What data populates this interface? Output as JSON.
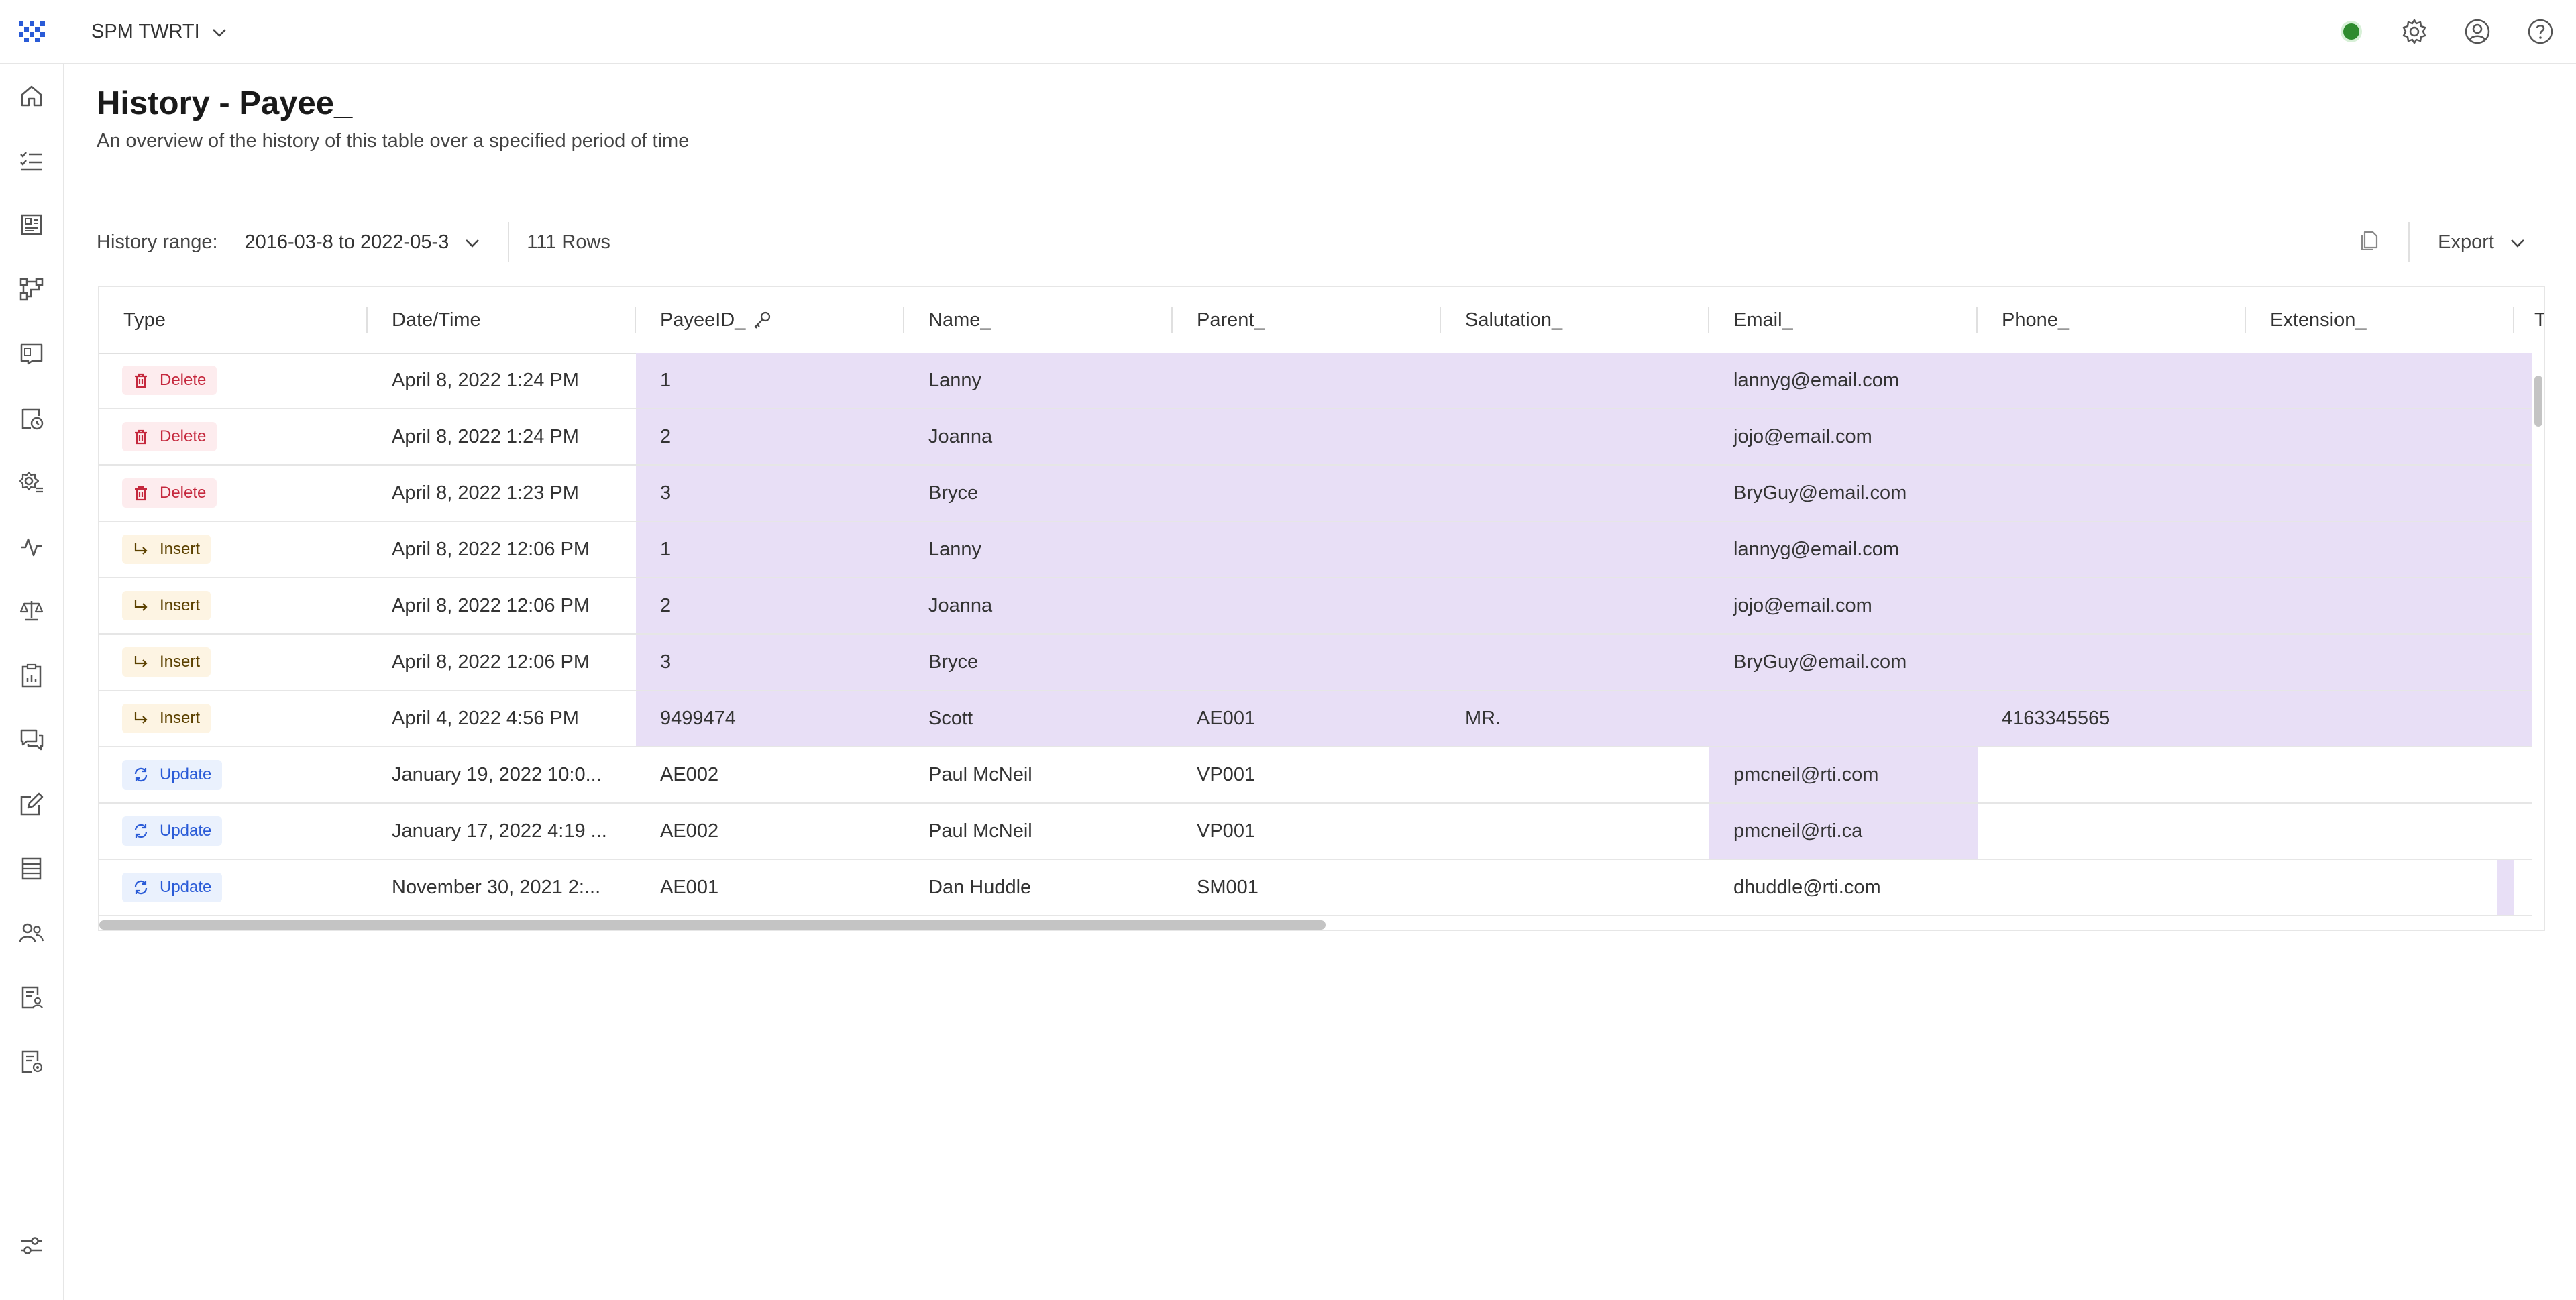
{
  "app": {
    "workspace_name": "SPM TWRTI"
  },
  "page": {
    "title": "History - Payee_",
    "subtitle": "An overview of the history of this table over a specified period of time"
  },
  "toolbar": {
    "history_range_label": "History range:",
    "history_range_value": "2016-03-8 to 2022-05-3",
    "row_count": "111 Rows",
    "export_label": "Export"
  },
  "status_color": "#2e8b2e",
  "colors": {
    "highlight": "#e8dff6",
    "delete": "#c5283d",
    "insert": "#5c4100",
    "update": "#2a5bd7"
  },
  "table": {
    "columns": [
      "Type",
      "Date/Time",
      "PayeeID_",
      "Name_",
      "Parent_",
      "Salutation_",
      "Email_",
      "Phone_",
      "Extension_",
      "T"
    ],
    "rows": [
      {
        "type": "Delete",
        "datetime": "April 8, 2022 1:24 PM",
        "payee_id": "1",
        "name": "Lanny",
        "parent": "",
        "salutation": "",
        "email": "lannyg@email.com",
        "phone": "",
        "extension": ""
      },
      {
        "type": "Delete",
        "datetime": "April 8, 2022 1:24 PM",
        "payee_id": "2",
        "name": "Joanna",
        "parent": "",
        "salutation": "",
        "email": "jojo@email.com",
        "phone": "",
        "extension": ""
      },
      {
        "type": "Delete",
        "datetime": "April 8, 2022 1:23 PM",
        "payee_id": "3",
        "name": "Bryce",
        "parent": "",
        "salutation": "",
        "email": "BryGuy@email.com",
        "phone": "",
        "extension": ""
      },
      {
        "type": "Insert",
        "datetime": "April 8, 2022 12:06 PM",
        "payee_id": "1",
        "name": "Lanny",
        "parent": "",
        "salutation": "",
        "email": "lannyg@email.com",
        "phone": "",
        "extension": ""
      },
      {
        "type": "Insert",
        "datetime": "April 8, 2022 12:06 PM",
        "payee_id": "2",
        "name": "Joanna",
        "parent": "",
        "salutation": "",
        "email": "jojo@email.com",
        "phone": "",
        "extension": ""
      },
      {
        "type": "Insert",
        "datetime": "April 8, 2022 12:06 PM",
        "payee_id": "3",
        "name": "Bryce",
        "parent": "",
        "salutation": "",
        "email": "BryGuy@email.com",
        "phone": "",
        "extension": ""
      },
      {
        "type": "Insert",
        "datetime": "April 4, 2022 4:56 PM",
        "payee_id": "9499474",
        "name": "Scott",
        "parent": "AE001",
        "salutation": "MR.",
        "email": "",
        "phone": "4163345565",
        "extension": ""
      },
      {
        "type": "Update",
        "datetime": "January 19, 2022 10:0...",
        "payee_id": "AE002",
        "name": "Paul McNeil",
        "parent": "VP001",
        "salutation": "",
        "email": "pmcneil@rti.com",
        "phone": "",
        "extension": ""
      },
      {
        "type": "Update",
        "datetime": "January 17, 2022 4:19 ...",
        "payee_id": "AE002",
        "name": "Paul McNeil",
        "parent": "VP001",
        "salutation": "",
        "email": "pmcneil@rti.ca",
        "phone": "",
        "extension": ""
      },
      {
        "type": "Update",
        "datetime": "November 30, 2021 2:...",
        "payee_id": "AE001",
        "name": "Dan Huddle",
        "parent": "SM001",
        "salutation": "",
        "email": "dhuddle@rti.com",
        "phone": "",
        "extension": ""
      }
    ]
  }
}
